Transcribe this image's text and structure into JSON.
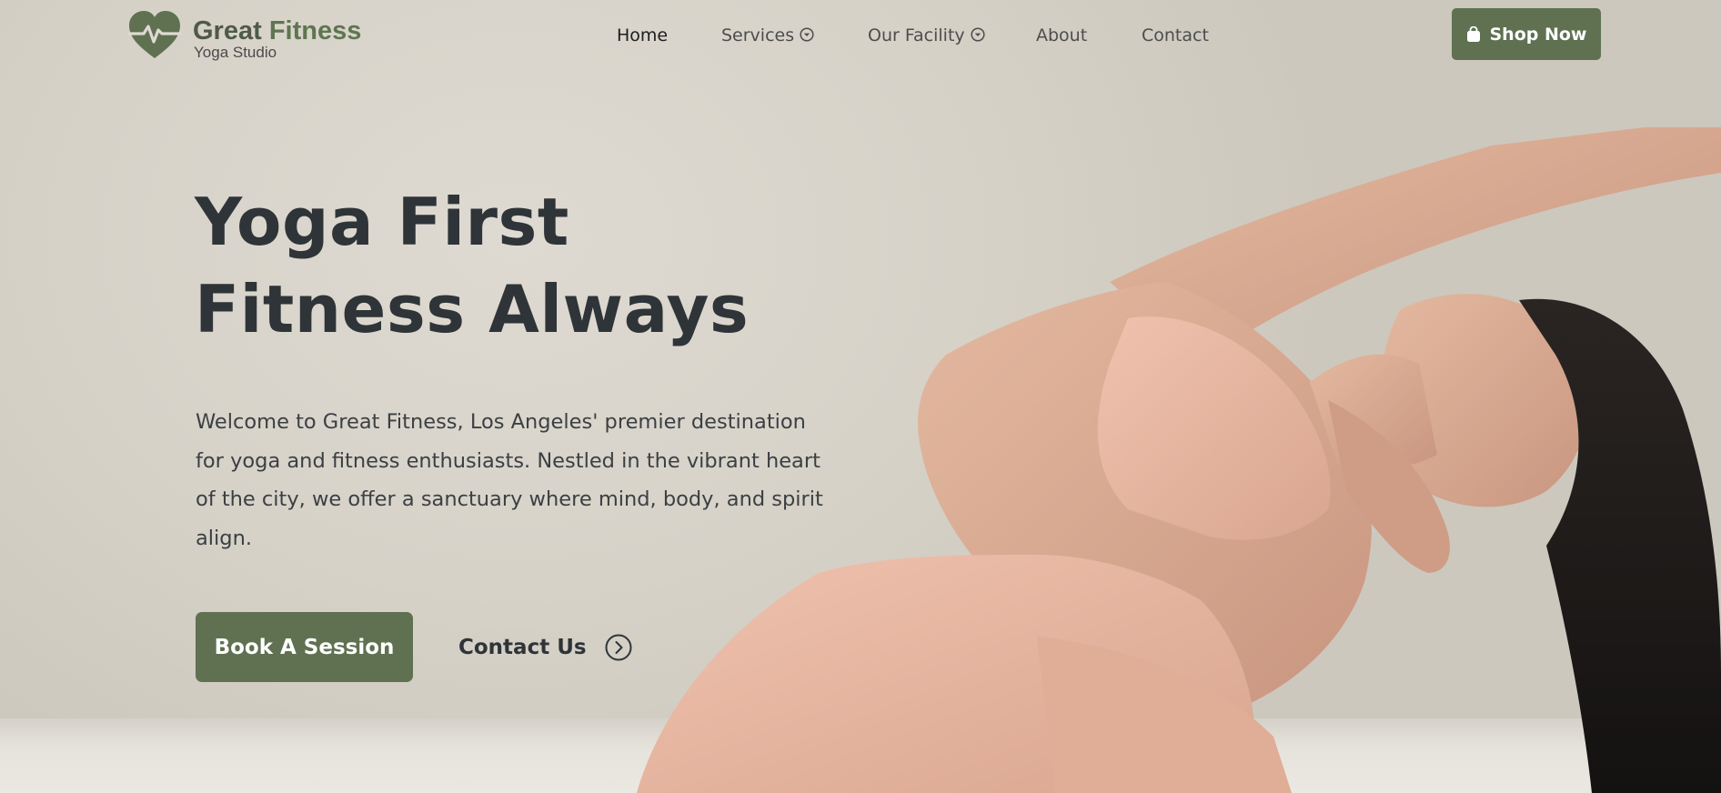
{
  "brand": {
    "name_part1": "Great",
    "name_part2": "Fitness",
    "tagline": "Yoga Studio",
    "logo_icon": "heart-pulse-icon"
  },
  "nav": {
    "items": [
      {
        "label": "Home",
        "active": true
      },
      {
        "label": "Services",
        "has_dropdown": true
      },
      {
        "label": "Our Facility",
        "has_dropdown": true
      },
      {
        "label": "About"
      },
      {
        "label": "Contact"
      }
    ]
  },
  "header": {
    "shop_label": "Shop Now",
    "shop_icon": "shopping-bag-icon"
  },
  "hero": {
    "headline_line1": "Yoga First",
    "headline_line2": "Fitness Always",
    "intro": "Welcome to Great Fitness, Los Angeles' premier destination for yoga and fitness enthusiasts. Nestled in the vibrant heart of the city, we offer a sanctuary where mind, body, and spirit align.",
    "primary_cta": "Book A Session",
    "secondary_cta": "Contact Us",
    "secondary_cta_icon": "chevron-right-circle-icon",
    "image": "woman-yoga-side-stretch-photo"
  },
  "colors": {
    "accent": "#5f7151",
    "heading": "#2f3438",
    "body_text": "#3c3f43",
    "background": "#d9d5cc"
  }
}
